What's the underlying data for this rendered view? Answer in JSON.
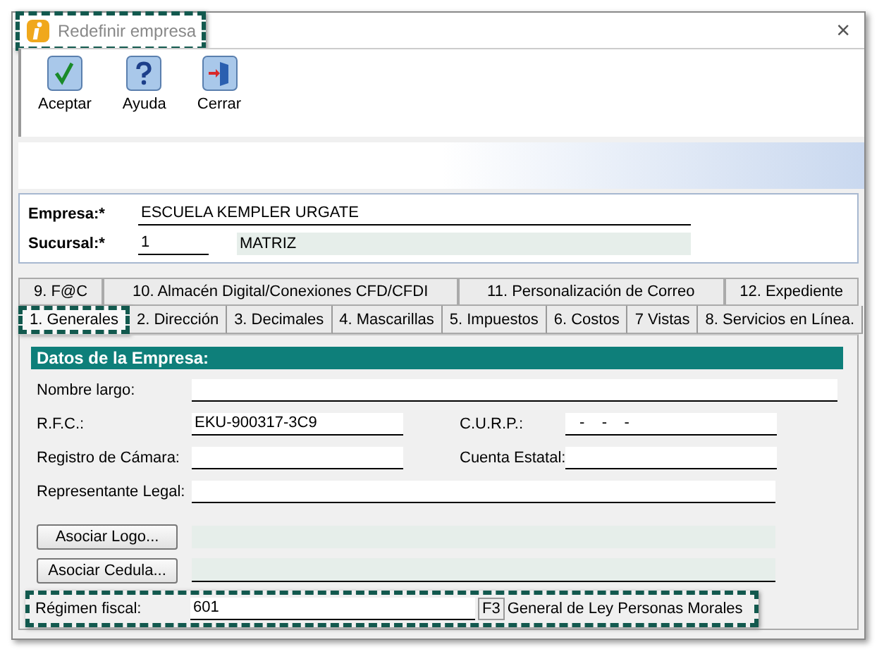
{
  "window": {
    "title": "Redefinir empresa",
    "title_highlighted": true,
    "close": "×"
  },
  "toolbar": [
    {
      "kind": "accept",
      "label": "Aceptar"
    },
    {
      "kind": "help",
      "label": "Ayuda"
    },
    {
      "kind": "close",
      "label": "Cerrar"
    }
  ],
  "company": {
    "empresa_label": "Empresa:*",
    "empresa_value": "ESCUELA KEMPLER URGATE",
    "sucursal_label": "Sucursal:*",
    "sucursal_value": "1",
    "sucursal_name": "MATRIZ"
  },
  "tabs_back": [
    {
      "label": "9. F@C",
      "selected": false
    },
    {
      "label": "10. Almacén Digital/Conexiones CFD/CFDI",
      "selected": false
    },
    {
      "label": "11. Personalización de Correo",
      "selected": false
    },
    {
      "label": "12. Expediente",
      "selected": false
    }
  ],
  "tabs_front": [
    {
      "label": "1. Generales",
      "selected": true,
      "highlighted": true
    },
    {
      "label": "2. Dirección",
      "selected": false,
      "highlighted": false
    },
    {
      "label": "3. Decimales",
      "selected": false,
      "highlighted": false
    },
    {
      "label": "4. Mascarillas",
      "selected": false,
      "highlighted": false
    },
    {
      "label": "5. Impuestos",
      "selected": false,
      "highlighted": false
    },
    {
      "label": "6. Costos",
      "selected": false,
      "highlighted": false
    },
    {
      "label": "7 Vistas",
      "selected": false,
      "highlighted": false
    },
    {
      "label": "8. Servicios en Línea.",
      "selected": false,
      "highlighted": false
    }
  ],
  "section": {
    "title": "Datos de la Empresa:",
    "nombre_largo": {
      "label": "Nombre largo:"
    },
    "rfc": {
      "label": "R.F.C.:",
      "value": "EKU-900317-3C9"
    },
    "curp": {
      "label": "C.U.R.P.:",
      "value": "-    -    -"
    },
    "registro": {
      "label": "Registro de Cámara:"
    },
    "cuenta": {
      "label": "Cuenta Estatal:"
    },
    "representante": {
      "label": "Representante Legal:"
    },
    "logo_button": "Asociar Logo...",
    "cedula_button": "Asociar Cedula...",
    "regimen": {
      "label": "Régimen fiscal:",
      "value": "601",
      "key": "F3",
      "description": "General de Ley Personas Morales",
      "highlighted": true
    }
  }
}
